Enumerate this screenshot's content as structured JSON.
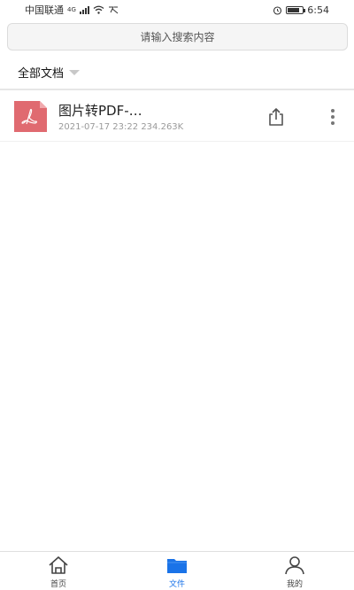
{
  "status_bar": {
    "carrier": "中国联通",
    "network": "4G",
    "time": "6:54",
    "battery_level": 0.8
  },
  "search": {
    "placeholder": "请输入搜索内容"
  },
  "filter": {
    "label": "全部文档"
  },
  "files": [
    {
      "name": "图片转PDF-…",
      "date": "2021-07-17 23:22",
      "size": "234.263K",
      "icon": "pdf-icon"
    }
  ],
  "bottom_nav": {
    "items": [
      {
        "label": "首页",
        "icon": "home-icon",
        "active": false
      },
      {
        "label": "文件",
        "icon": "folder-icon",
        "active": true
      },
      {
        "label": "我的",
        "icon": "user-icon",
        "active": false
      }
    ]
  },
  "colors": {
    "accent": "#1a73e8",
    "pdf": "#e06a70"
  }
}
